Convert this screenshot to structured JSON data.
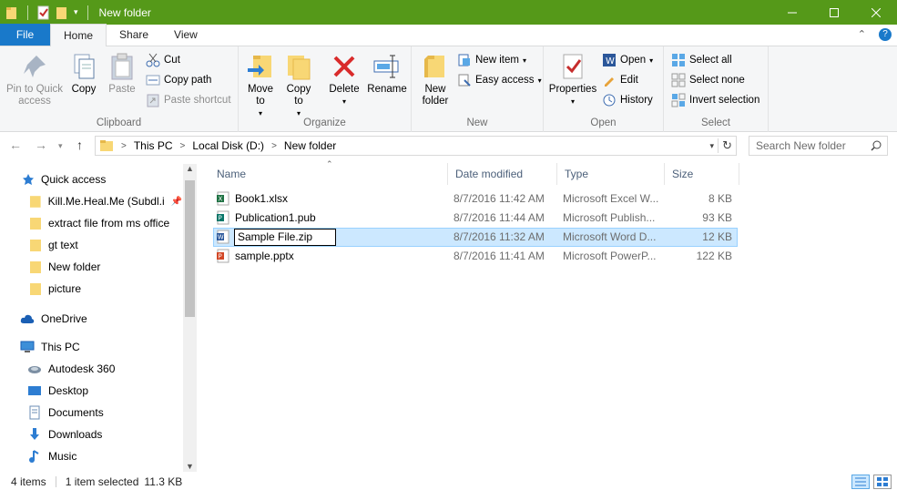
{
  "window": {
    "title": "New folder"
  },
  "tabs": {
    "file": "File",
    "home": "Home",
    "share": "Share",
    "view": "View"
  },
  "ribbon": {
    "clipboard": {
      "label": "Clipboard",
      "pin": "Pin to Quick access",
      "copy": "Copy",
      "paste": "Paste",
      "cut": "Cut",
      "copy_path": "Copy path",
      "paste_shortcut": "Paste shortcut"
    },
    "organize": {
      "label": "Organize",
      "move_to": "Move to",
      "copy_to": "Copy to",
      "delete": "Delete",
      "rename": "Rename"
    },
    "new": {
      "label": "New",
      "new_folder": "New folder",
      "new_item": "New item",
      "easy_access": "Easy access"
    },
    "open": {
      "label": "Open",
      "properties": "Properties",
      "open": "Open",
      "edit": "Edit",
      "history": "History"
    },
    "select": {
      "label": "Select",
      "select_all": "Select all",
      "select_none": "Select none",
      "invert": "Invert selection"
    }
  },
  "address": {
    "crumbs": [
      "This PC",
      "Local Disk (D:)",
      "New folder"
    ],
    "search_placeholder": "Search New folder"
  },
  "nav": {
    "quick_access": "Quick access",
    "pinned": [
      "Kill.Me.Heal.Me (Subdl.iR",
      "extract file from ms office",
      "gt text",
      "New folder",
      "picture"
    ],
    "onedrive": "OneDrive",
    "this_pc": "This PC",
    "pc_items": [
      "Autodesk 360",
      "Desktop",
      "Documents",
      "Downloads",
      "Music"
    ]
  },
  "columns": {
    "name": "Name",
    "date": "Date modified",
    "type": "Type",
    "size": "Size"
  },
  "files": [
    {
      "name": "Book1.xlsx",
      "date": "8/7/2016 11:42 AM",
      "type": "Microsoft Excel W...",
      "size": "8 KB",
      "icon": "excel-icon",
      "color": "#1f7244"
    },
    {
      "name": "Publication1.pub",
      "date": "8/7/2016 11:44 AM",
      "type": "Microsoft Publish...",
      "size": "93 KB",
      "icon": "publisher-icon",
      "color": "#077568"
    },
    {
      "name": "Sample File.zip",
      "date": "8/7/2016 11:32 AM",
      "type": "Microsoft Word D...",
      "size": "12 KB",
      "icon": "word-icon",
      "color": "#2b579a"
    },
    {
      "name": "sample.pptx",
      "date": "8/7/2016 11:41 AM",
      "type": "Microsoft PowerP...",
      "size": "122 KB",
      "icon": "powerpoint-icon",
      "color": "#d24726"
    }
  ],
  "status": {
    "count": "4 items",
    "selected": "1 item selected",
    "size": "11.3 KB"
  }
}
